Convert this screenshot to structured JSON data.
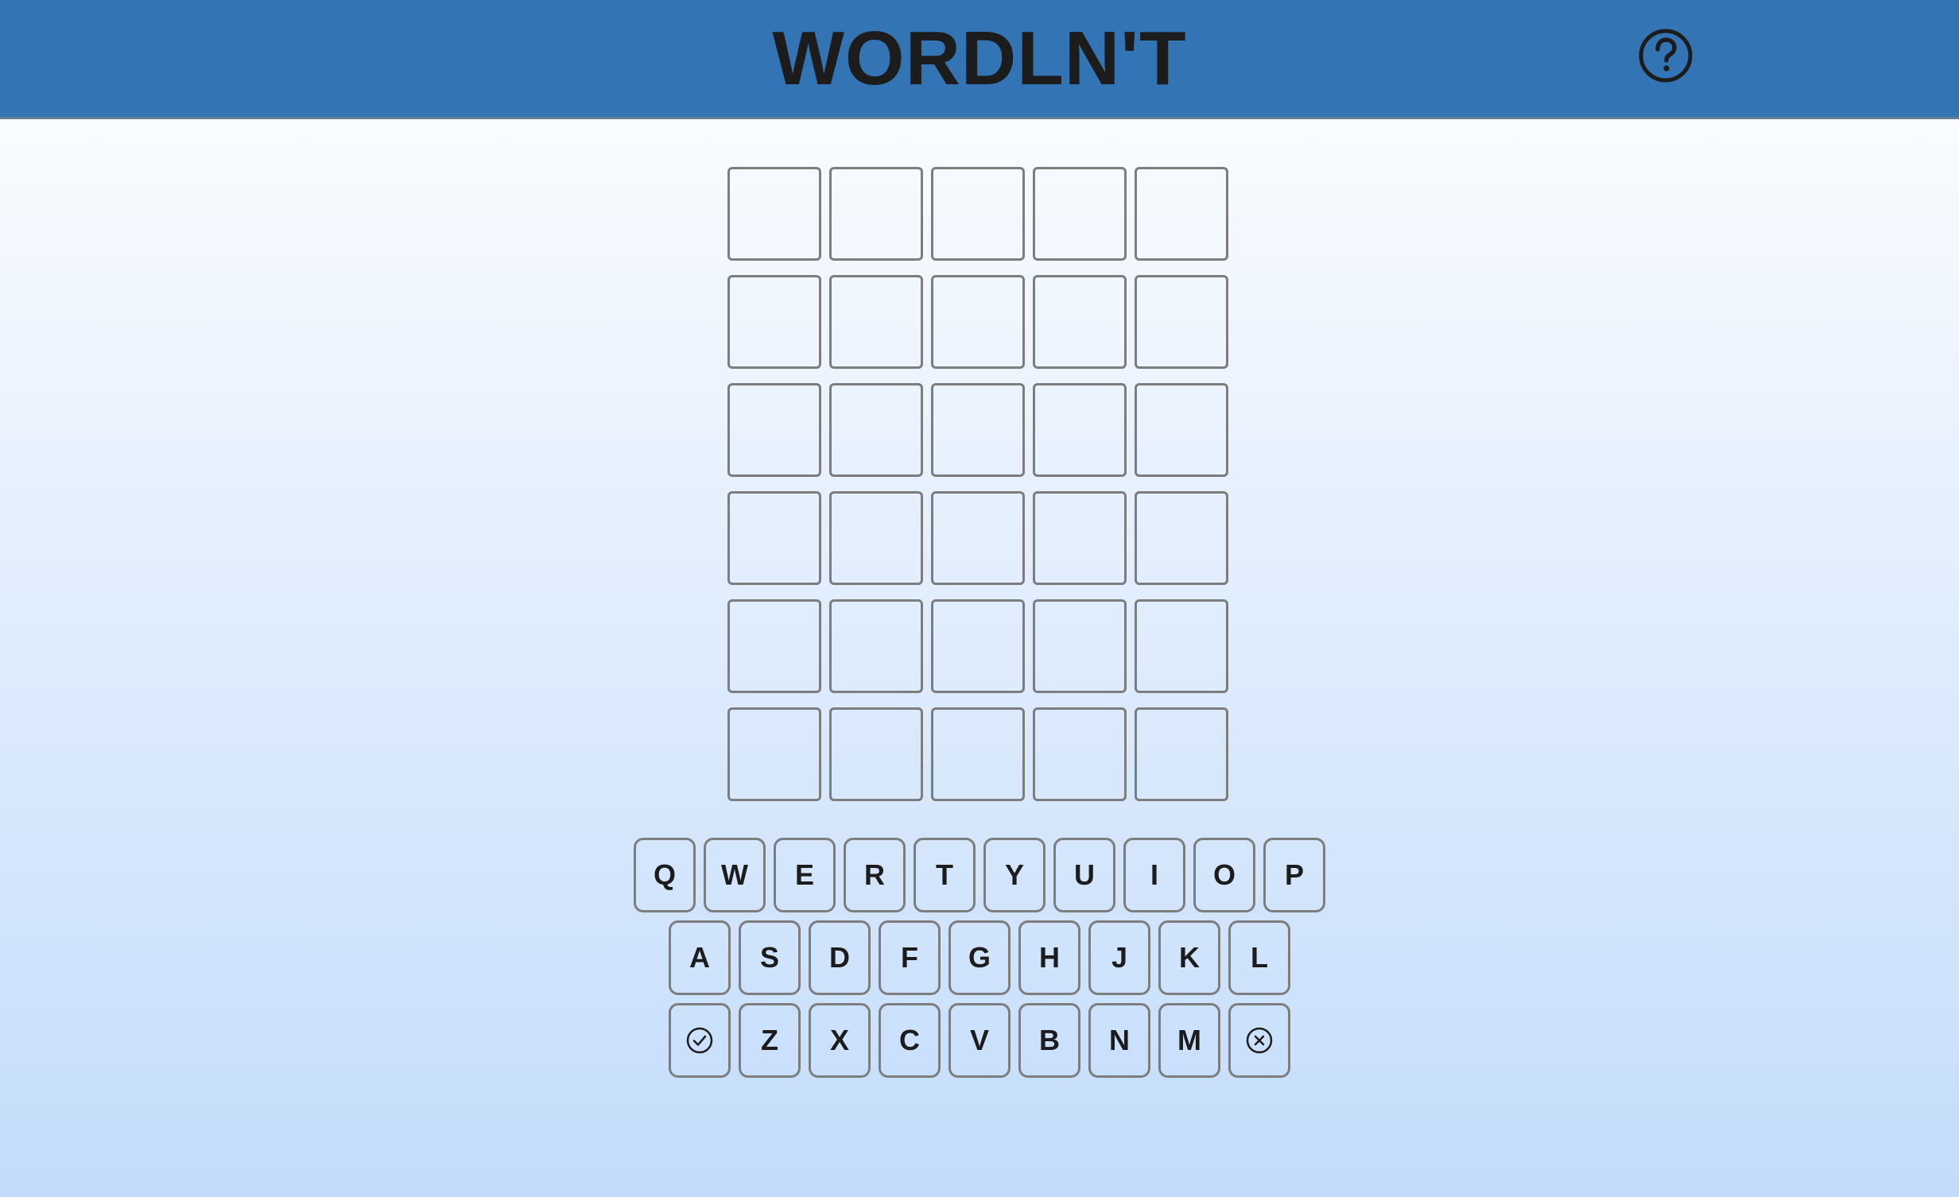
{
  "header": {
    "title": "WORDLN'T",
    "help_icon": "question-circle-icon"
  },
  "colors": {
    "header_bg": "#3374b4",
    "text": "#1c1c1c",
    "tile_border": "#7d7d7d",
    "bg_top": "#ffffff",
    "bg_bottom": "#c3dcfb"
  },
  "board": {
    "rows": [
      [
        "",
        "",
        "",
        "",
        ""
      ],
      [
        "",
        "",
        "",
        "",
        ""
      ],
      [
        "",
        "",
        "",
        "",
        ""
      ],
      [
        "",
        "",
        "",
        "",
        ""
      ],
      [
        "",
        "",
        "",
        "",
        ""
      ],
      [
        "",
        "",
        "",
        "",
        ""
      ]
    ]
  },
  "keyboard": {
    "row1": [
      "Q",
      "W",
      "E",
      "R",
      "T",
      "Y",
      "U",
      "I",
      "O",
      "P"
    ],
    "row2": [
      "A",
      "S",
      "D",
      "F",
      "G",
      "H",
      "J",
      "K",
      "L"
    ],
    "row3": [
      "Z",
      "X",
      "C",
      "V",
      "B",
      "N",
      "M"
    ],
    "enter_icon": "check-circle-icon",
    "delete_icon": "x-circle-icon"
  }
}
